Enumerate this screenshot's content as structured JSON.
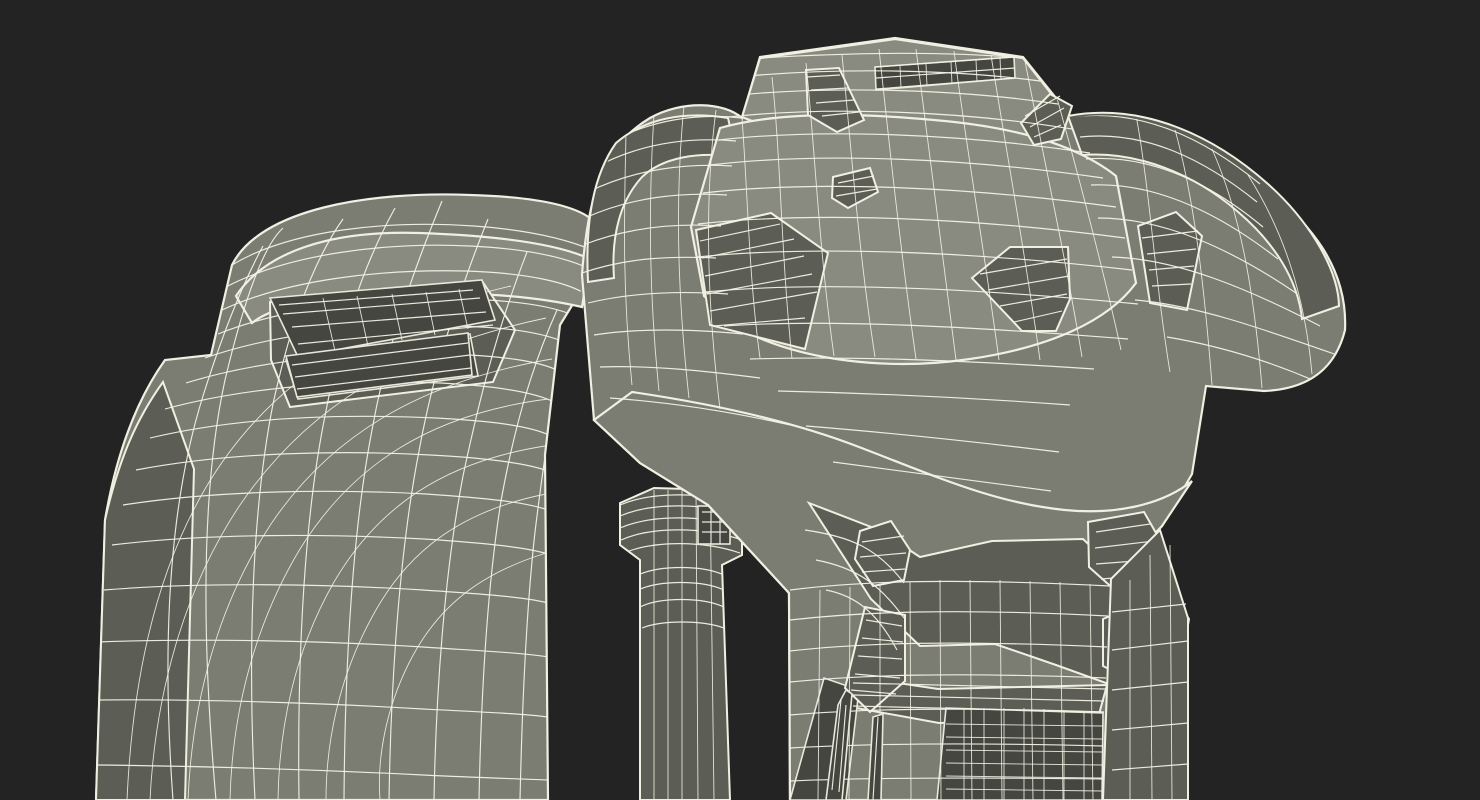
{
  "scene": {
    "background_color": "#232323",
    "surface_color": "#7b7c72",
    "wire_color": "#f3f2e6",
    "render_style": "wireframe-over-shaded"
  }
}
